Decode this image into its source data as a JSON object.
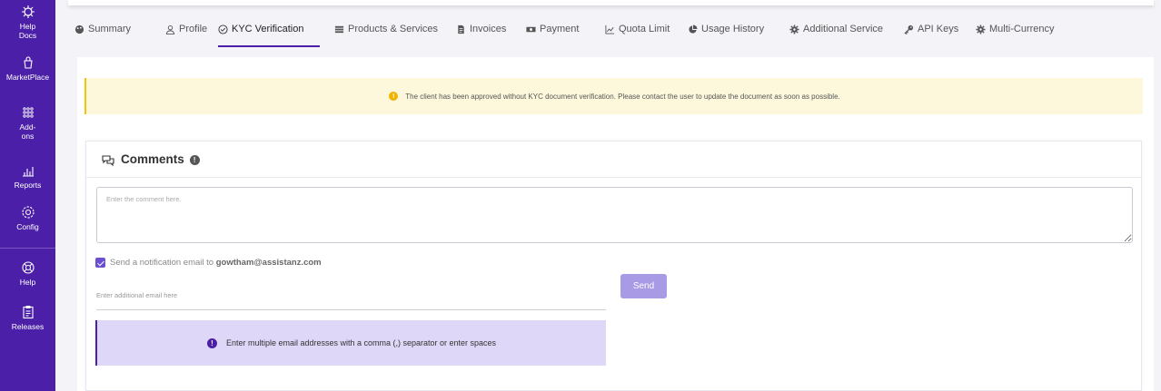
{
  "sidebar": {
    "items": [
      {
        "label": "Help Docs",
        "icon": "gear-help-icon"
      },
      {
        "label": "MarketPlace",
        "icon": "bag-icon"
      },
      {
        "label": "Add-ons",
        "icon": "grid-icon"
      },
      {
        "label": "Reports",
        "icon": "bar-chart-icon"
      },
      {
        "label": "Config",
        "icon": "settings-icon"
      },
      {
        "label": "Help",
        "icon": "lifebuoy-icon"
      },
      {
        "label": "Releases",
        "icon": "clipboard-icon"
      }
    ],
    "color": "#4b1fa8"
  },
  "tabs": [
    {
      "label": "Summary",
      "icon": "palette-icon"
    },
    {
      "label": "Profile",
      "icon": "user-icon"
    },
    {
      "label": "KYC Verification",
      "icon": "check-circle-icon",
      "active": true
    },
    {
      "label": "Products & Services",
      "icon": "list-icon"
    },
    {
      "label": "Invoices",
      "icon": "file-icon"
    },
    {
      "label": "Payment",
      "icon": "money-icon"
    },
    {
      "label": "Quota Limit",
      "icon": "line-chart-icon"
    },
    {
      "label": "Usage History",
      "icon": "pie-chart-icon"
    },
    {
      "label": "Additional Service",
      "icon": "cog-icon"
    },
    {
      "label": "API Keys",
      "icon": "key-icon"
    },
    {
      "label": "Multi-Currency",
      "icon": "cog-icon"
    }
  ],
  "warning": {
    "text": "The client has been approved without KYC document verification. Please contact the user to update the document as soon as possible."
  },
  "comments": {
    "title": "Comments",
    "textarea_placeholder": "Enter the comment here.",
    "notify_prefix": "Send a notification email to ",
    "notify_email": "gowtham@assistanz.com",
    "notify_checked": true,
    "email_placeholder": "Enter additional email here",
    "send_label": "Send",
    "info_text": "Enter multiple email addresses with a comma (,) separator or enter spaces"
  }
}
